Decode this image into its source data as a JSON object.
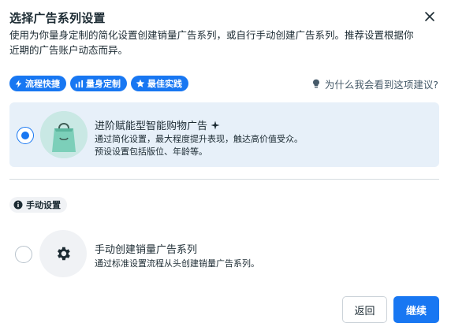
{
  "dialog": {
    "title": "选择广告系列设置",
    "description": "使用为你量身定制的简化设置创建销量广告系列，或自行手动创建广告系列。推荐设置根据你近期的广告账户动态而异。",
    "close_icon": "close-icon"
  },
  "chips": [
    {
      "label": "流程快捷",
      "icon": "lightning-icon"
    },
    {
      "label": "量身定制",
      "icon": "bar-chart-icon"
    },
    {
      "label": "最佳实践",
      "icon": "star-icon"
    }
  ],
  "why_link": {
    "label": "为什么我会看到这项建议?",
    "icon": "lightbulb-icon"
  },
  "options": {
    "advantage": {
      "title": "进阶赋能型智能购物广告",
      "sparkle_icon": "sparkle-icon",
      "desc_line1": "通过简化设置，最大程度提升表现，触达高价值受众。",
      "desc_line2": "预设设置包括版位、年龄等。",
      "selected": true,
      "image": "shopping-bag-icon"
    },
    "manual_section": {
      "label": "手动设置",
      "icon": "info-icon"
    },
    "manual": {
      "title": "手动创建销量广告系列",
      "desc": "通过标准设置流程从头创建销量广告系列。",
      "selected": false,
      "icon": "gear-icon"
    }
  },
  "buttons": {
    "back": "返回",
    "continue": "继续"
  },
  "colors": {
    "accent": "#1877f2",
    "selected_bg": "#e7f0f9",
    "text": "#1c2b33",
    "muted": "#465a69"
  }
}
